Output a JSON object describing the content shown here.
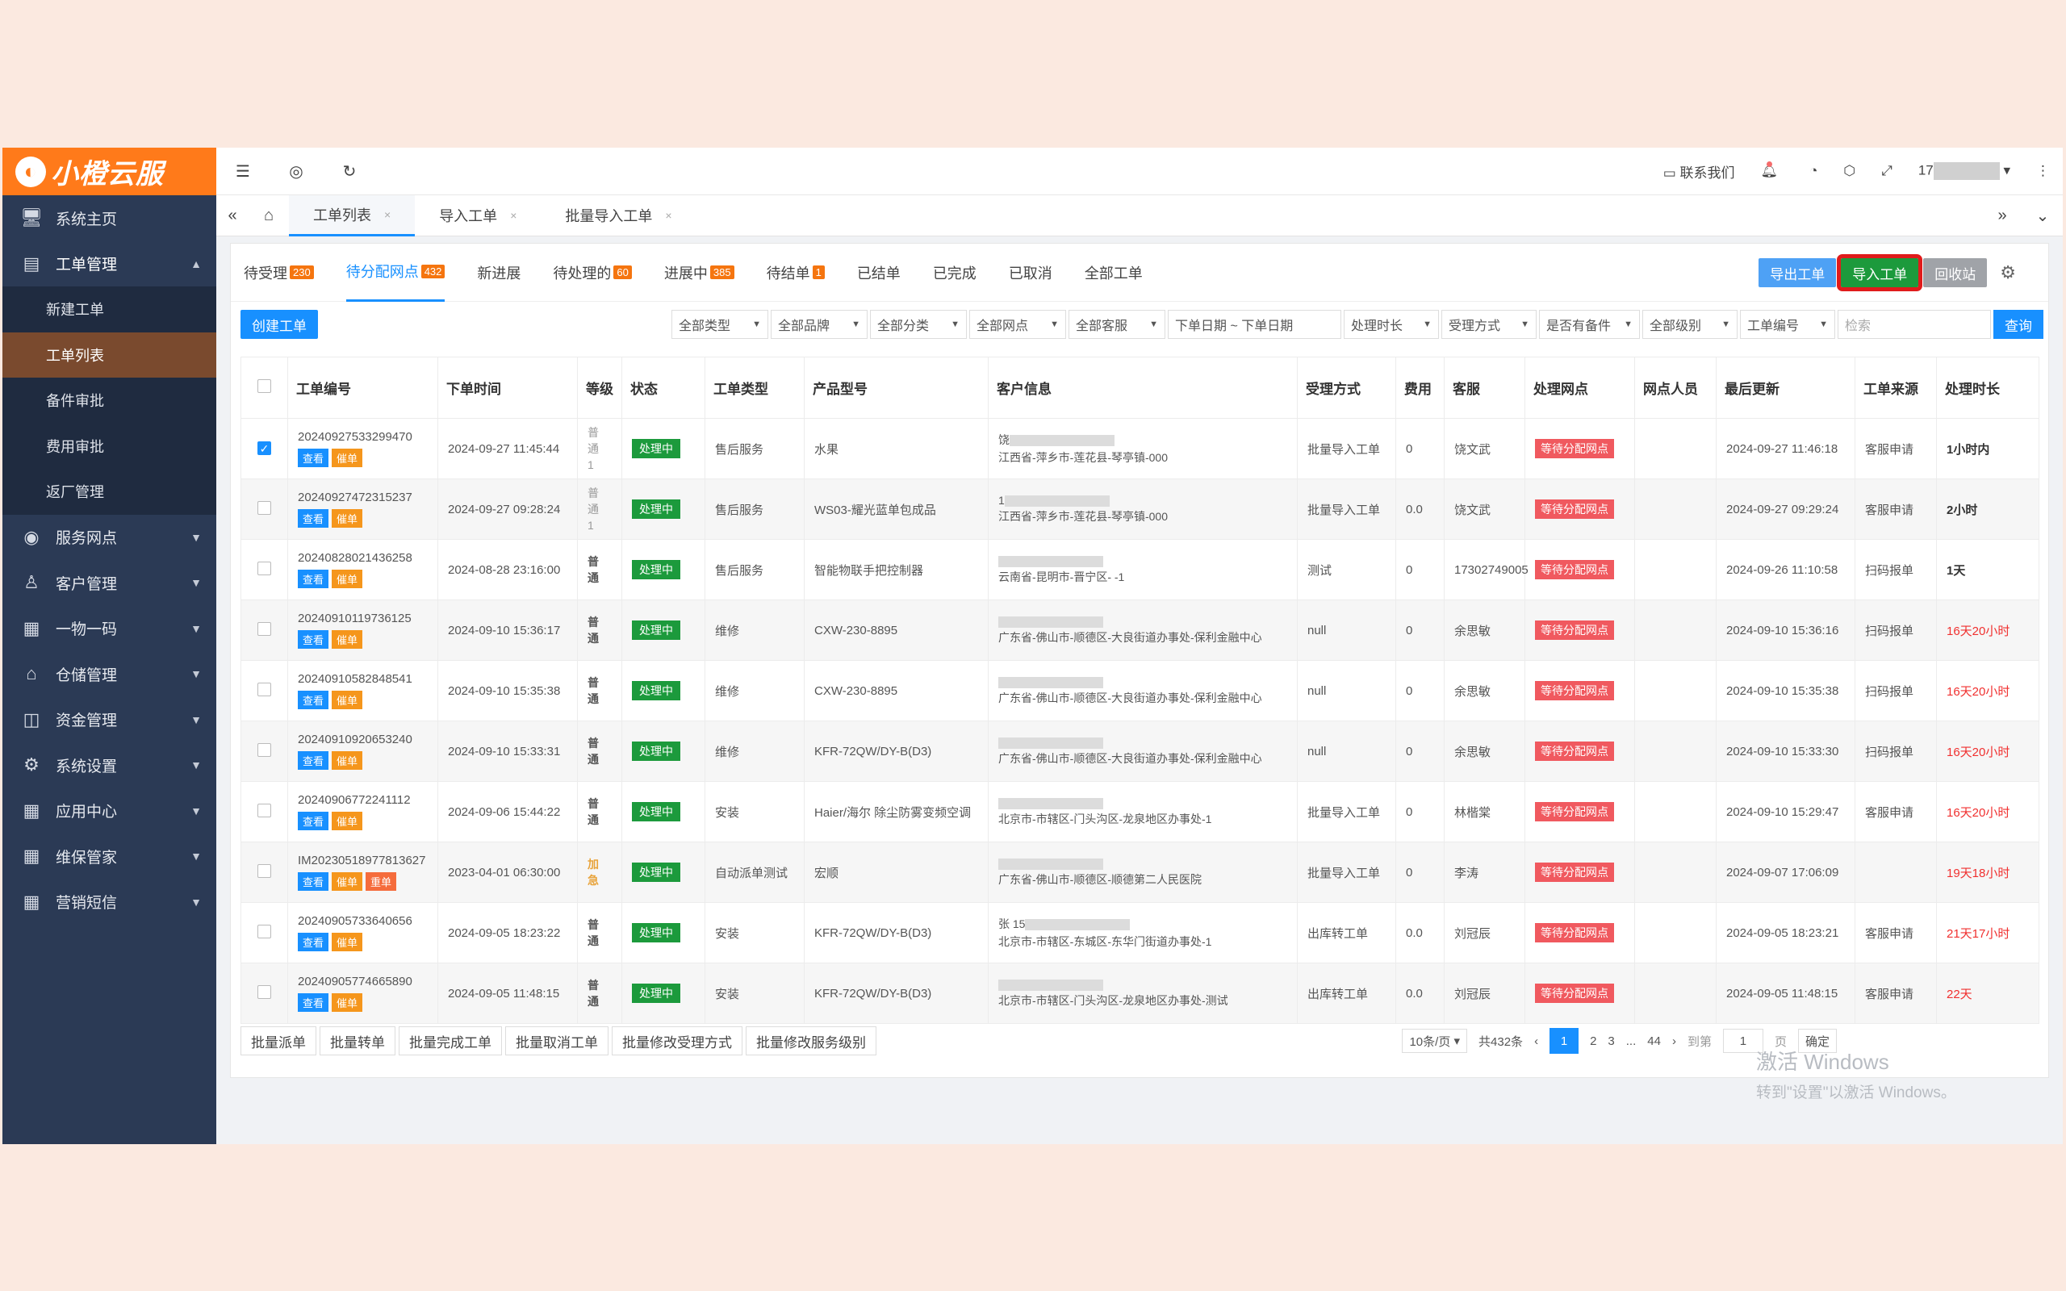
{
  "app": {
    "logo_text": "小橙云服",
    "brand_color": "#ff7a1a"
  },
  "sidebar": {
    "items": [
      {
        "label": "系统主页",
        "icon": "monitor-icon"
      },
      {
        "label": "工单管理",
        "icon": "document-icon",
        "open": true
      },
      {
        "label": "服务网点",
        "icon": "globe-icon"
      },
      {
        "label": "客户管理",
        "icon": "user-icon"
      },
      {
        "label": "一物一码",
        "icon": "grid-icon"
      },
      {
        "label": "仓储管理",
        "icon": "bank-icon"
      },
      {
        "label": "资金管理",
        "icon": "money-icon"
      },
      {
        "label": "系统设置",
        "icon": "gear-icon"
      },
      {
        "label": "应用中心",
        "icon": "grid-icon"
      },
      {
        "label": "维保管家",
        "icon": "grid-icon"
      },
      {
        "label": "营销短信",
        "icon": "grid-icon"
      }
    ],
    "sub_items": [
      "新建工单",
      "工单列表",
      "备件审批",
      "费用审批",
      "返厂管理"
    ]
  },
  "topbar": {
    "contact": "联系我们",
    "user": "17"
  },
  "page_tabs": [
    "工单列表",
    "导入工单",
    "批量导入工单"
  ],
  "status_tabs": [
    {
      "label": "待受理",
      "badge": "230"
    },
    {
      "label": "待分配网点",
      "badge": "432"
    },
    {
      "label": "新进展",
      "badge": ""
    },
    {
      "label": "待处理的",
      "badge": "60"
    },
    {
      "label": "进展中",
      "badge": "385"
    },
    {
      "label": "待结单",
      "badge": "1"
    },
    {
      "label": "已结单",
      "badge": ""
    },
    {
      "label": "已完成",
      "badge": ""
    },
    {
      "label": "已取消",
      "badge": ""
    },
    {
      "label": "全部工单",
      "badge": ""
    }
  ],
  "actions": {
    "export": "导出工单",
    "import": "导入工单",
    "recycle": "回收站"
  },
  "create_button": "创建工单",
  "filters": [
    "全部类型",
    "全部品牌",
    "全部分类",
    "全部网点",
    "全部客服"
  ],
  "date_range": "下单日期 ~ 下单日期",
  "filters2": [
    "处理时长",
    "受理方式",
    "是否有备件",
    "全部级别",
    "工单编号"
  ],
  "search_placeholder": "检索",
  "query_button": "查询",
  "table": {
    "headers": [
      "工单编号",
      "下单时间",
      "等级",
      "状态",
      "工单类型",
      "产品型号",
      "客户信息",
      "受理方式",
      "费用",
      "客服",
      "处理网点",
      "网点人员",
      "最后更新",
      "工单来源",
      "处理时长"
    ],
    "rows": [
      {
        "id": "20240927533299470",
        "time": "2024-09-27 11:45:44",
        "grade": "普通1",
        "status": "处理中",
        "type": "售后服务",
        "model": "水果",
        "cust1": "饶",
        "cust2": "江西省-萍乡市-莲花县-琴亭镇-000",
        "accept": "批量导入工单",
        "fee": "0",
        "cs": "饶文武",
        "net": "等待分配网点",
        "updated": "2024-09-27 11:46:18",
        "source": "客服申请",
        "duration": "1小时内",
        "red": false,
        "checked": true,
        "urge": false
      },
      {
        "id": "20240927472315237",
        "time": "2024-09-27 09:28:24",
        "grade": "普通1",
        "status": "处理中",
        "type": "售后服务",
        "model": "WS03-耀光蓝单包成品",
        "cust1": "1",
        "cust2": "江西省-萍乡市-莲花县-琴亭镇-000",
        "accept": "批量导入工单",
        "fee": "0.0",
        "cs": "饶文武",
        "net": "等待分配网点",
        "updated": "2024-09-27 09:29:24",
        "source": "客服申请",
        "duration": "2小时",
        "red": false,
        "checked": false,
        "urge": false
      },
      {
        "id": "20240828021436258",
        "time": "2024-08-28 23:16:00",
        "grade": "普通",
        "status": "处理中",
        "type": "售后服务",
        "model": "智能物联手把控制器",
        "cust1": "",
        "cust2": "云南省-昆明市-晋宁区- -1",
        "accept": "测试",
        "fee": "0",
        "cs": "17302749005",
        "net": "等待分配网点",
        "updated": "2024-09-26 11:10:58",
        "source": "扫码报单",
        "duration": "1天",
        "red": false,
        "checked": false,
        "urge": false
      },
      {
        "id": "20240910119736125",
        "time": "2024-09-10 15:36:17",
        "grade": "普通",
        "status": "处理中",
        "type": "维修",
        "model": "CXW-230-8895",
        "cust1": "",
        "cust2": "广东省-佛山市-顺德区-大良街道办事处-保利金融中心",
        "accept": "null",
        "fee": "0",
        "cs": "余思敏",
        "net": "等待分配网点",
        "updated": "2024-09-10 15:36:16",
        "source": "扫码报单",
        "duration": "16天20小时",
        "red": true,
        "checked": false,
        "urge": false
      },
      {
        "id": "20240910582848541",
        "time": "2024-09-10 15:35:38",
        "grade": "普通",
        "status": "处理中",
        "type": "维修",
        "model": "CXW-230-8895",
        "cust1": "",
        "cust2": "广东省-佛山市-顺德区-大良街道办事处-保利金融中心",
        "accept": "null",
        "fee": "0",
        "cs": "余思敏",
        "net": "等待分配网点",
        "updated": "2024-09-10 15:35:38",
        "source": "扫码报单",
        "duration": "16天20小时",
        "red": true,
        "checked": false,
        "urge": false
      },
      {
        "id": "20240910920653240",
        "time": "2024-09-10 15:33:31",
        "grade": "普通",
        "status": "处理中",
        "type": "维修",
        "model": "KFR-72QW/DY-B(D3)",
        "cust1": "",
        "cust2": "广东省-佛山市-顺德区-大良街道办事处-保利金融中心",
        "accept": "null",
        "fee": "0",
        "cs": "余思敏",
        "net": "等待分配网点",
        "updated": "2024-09-10 15:33:30",
        "source": "扫码报单",
        "duration": "16天20小时",
        "red": true,
        "checked": false,
        "urge": false
      },
      {
        "id": "20240906772241112",
        "time": "2024-09-06 15:44:22",
        "grade": "普通",
        "status": "处理中",
        "type": "安装",
        "model": "Haier/海尔 除尘防雾变频空调",
        "cust1": "",
        "cust2": "北京市-市辖区-门头沟区-龙泉地区办事处-1",
        "accept": "批量导入工单",
        "fee": "0",
        "cs": "林楷棠",
        "net": "等待分配网点",
        "updated": "2024-09-10 15:29:47",
        "source": "客服申请",
        "duration": "16天20小时",
        "red": true,
        "checked": false,
        "urge": false
      },
      {
        "id": "IM20230518977813627",
        "time": "2023-04-01 06:30:00",
        "grade": "加急",
        "status": "处理中",
        "type": "自动派单测试",
        "model": "宏顺",
        "cust1": "",
        "cust2": "广东省-佛山市-顺德区-顺德第二人民医院",
        "accept": "批量导入工单",
        "fee": "0",
        "cs": "李涛",
        "net": "等待分配网点",
        "updated": "2024-09-07 17:06:09",
        "source": "",
        "duration": "19天18小时",
        "red": true,
        "checked": false,
        "urge": true
      },
      {
        "id": "20240905733640656",
        "time": "2024-09-05 18:23:22",
        "grade": "普通",
        "status": "处理中",
        "type": "安装",
        "model": "KFR-72QW/DY-B(D3)",
        "cust1": "张 15",
        "cust2": "北京市-市辖区-东城区-东华门街道办事处-1",
        "accept": "出库转工单",
        "fee": "0.0",
        "cs": "刘冠辰",
        "net": "等待分配网点",
        "updated": "2024-09-05 18:23:21",
        "source": "客服申请",
        "duration": "21天17小时",
        "red": true,
        "checked": false,
        "urge": false
      },
      {
        "id": "20240905774665890",
        "time": "2024-09-05 11:48:15",
        "grade": "普通",
        "status": "处理中",
        "type": "安装",
        "model": "KFR-72QW/DY-B(D3)",
        "cust1": "",
        "cust2": "北京市-市辖区-门头沟区-龙泉地区办事处-测试",
        "accept": "出库转工单",
        "fee": "0.0",
        "cs": "刘冠辰",
        "net": "等待分配网点",
        "updated": "2024-09-05 11:48:15",
        "source": "客服申请",
        "duration": "22天",
        "red": true,
        "checked": false,
        "urge": false
      }
    ],
    "row_buttons": {
      "view": "查看",
      "urge": "催单",
      "redo": "重单"
    }
  },
  "batch_buttons": [
    "批量派单",
    "批量转单",
    "批量完成工单",
    "批量取消工单",
    "批量修改受理方式",
    "批量修改服务级别"
  ],
  "pager": {
    "per_page": "10条/页",
    "total": "共432条",
    "pages": [
      "1",
      "2",
      "3",
      "...",
      "44"
    ],
    "goto_label": "到第",
    "goto_value": "1",
    "page_unit": "页",
    "confirm": "确定"
  },
  "watermark": {
    "line1": "激活 Windows",
    "line2": "转到\"设置\"以激活 Windows。"
  }
}
